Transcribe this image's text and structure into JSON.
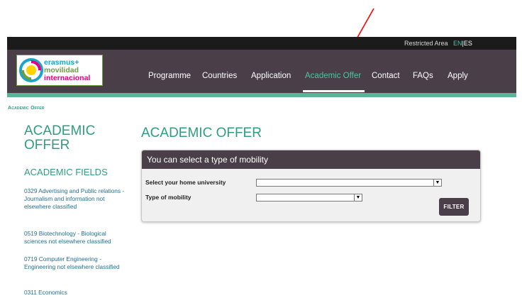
{
  "topbar": {
    "restricted_area": "Restricted Area",
    "lang_en": "EN",
    "lang_sep": "|",
    "lang_es": "ES"
  },
  "logo": {
    "line1": "erasmus+",
    "line2": "movilidad",
    "line3": "internacional"
  },
  "nav": {
    "items": [
      "Programme",
      "Countries",
      "Application",
      "Academic Offer",
      "Contact",
      "FAQs",
      "Apply"
    ],
    "active_index": 3
  },
  "breadcrumb": "Academic Offer",
  "sidebar": {
    "title": "ACADEMIC OFFER",
    "subtitle": "ACADEMIC FIELDS",
    "items": [
      "0329 Advertising and Public relations - Journalism and information not elsewhere classified",
      "0519 Biotechnology - Biological sciences not elsewhere classified",
      "0719 Computer Engineering - Engineering not elsewhere classified",
      "0311 Economics"
    ]
  },
  "main": {
    "title": "ACADEMIC OFFER",
    "panel_title": "You can select a type of mobility",
    "home_university_label": "Select your home university",
    "home_university_value": "",
    "mobility_type_label": "Type of mobility",
    "mobility_type_value": "",
    "filter_button": "FILTER"
  },
  "colors": {
    "accent_teal": "#2f9d7f",
    "header_dark": "#4a3f48",
    "annotation_arrow": "#ff0000"
  }
}
